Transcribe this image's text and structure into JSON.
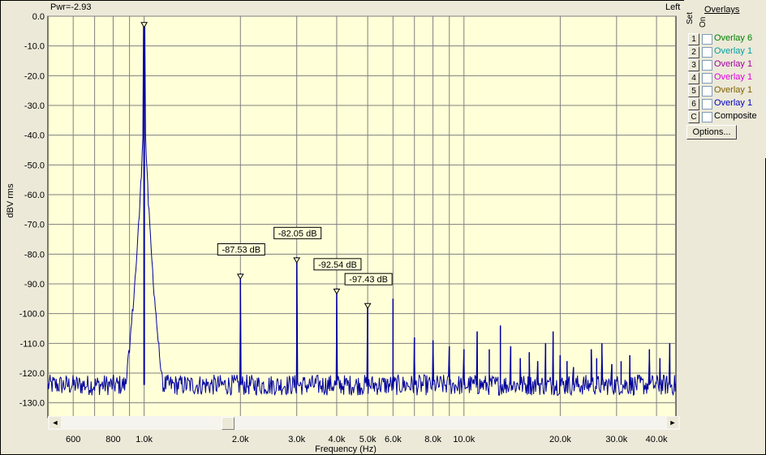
{
  "header": {
    "power_readout": "Pwr=-2.93",
    "channel": "Left"
  },
  "overlays": {
    "title": "Overlays",
    "set_header": "Set",
    "on_header": "On",
    "rows": [
      {
        "num": "1",
        "label": "Overlay 6",
        "color": "#008000",
        "checked": false
      },
      {
        "num": "2",
        "label": "Overlay 1",
        "color": "#00a0a0",
        "checked": false
      },
      {
        "num": "3",
        "label": "Overlay 1",
        "color": "#a000a0",
        "checked": false
      },
      {
        "num": "4",
        "label": "Overlay 1",
        "color": "#e000e0",
        "checked": false
      },
      {
        "num": "5",
        "label": "Overlay 1",
        "color": "#806000",
        "checked": false
      },
      {
        "num": "6",
        "label": "Overlay 1",
        "color": "#0000c0",
        "checked": false
      },
      {
        "num": "C",
        "label": "Composite",
        "color": "#000000",
        "checked": false
      }
    ],
    "options_label": "Options..."
  },
  "scrollbar": {
    "left_arrow": "◄",
    "right_arrow": "►",
    "position": 0.27
  },
  "chart_data": {
    "type": "line",
    "xlabel": "Frequency (Hz)",
    "ylabel": "dBV rms",
    "x_scale": "log",
    "xlim": [
      500,
      46000
    ],
    "ylim": [
      -135,
      0
    ],
    "grid": true,
    "background": "#ffffd8",
    "trace_color": "#0000a0",
    "x_ticks": [
      {
        "value": 600,
        "label": "600"
      },
      {
        "value": 800,
        "label": "800"
      },
      {
        "value": 1000,
        "label": "1.0k"
      },
      {
        "value": 2000,
        "label": "2.0k"
      },
      {
        "value": 3000,
        "label": "3.0k"
      },
      {
        "value": 4000,
        "label": "4.0k"
      },
      {
        "value": 5000,
        "label": "5.0k"
      },
      {
        "value": 6000,
        "label": "6.0k"
      },
      {
        "value": 8000,
        "label": "8.0k"
      },
      {
        "value": 10000,
        "label": "10.0k"
      },
      {
        "value": 20000,
        "label": "20.0k"
      },
      {
        "value": 30000,
        "label": "30.0k"
      },
      {
        "value": 40000,
        "label": "40.0k"
      }
    ],
    "y_ticks": [
      {
        "value": 0,
        "label": "0.0"
      },
      {
        "value": -10,
        "label": "-10.0"
      },
      {
        "value": -20,
        "label": "-20.0"
      },
      {
        "value": -30,
        "label": "-30.0"
      },
      {
        "value": -40,
        "label": "-40.0"
      },
      {
        "value": -50,
        "label": "-50.0"
      },
      {
        "value": -60,
        "label": "-60.0"
      },
      {
        "value": -70,
        "label": "-70.0"
      },
      {
        "value": -80,
        "label": "-80.0"
      },
      {
        "value": -90,
        "label": "-90.0"
      },
      {
        "value": -100,
        "label": "-100.0"
      },
      {
        "value": -110,
        "label": "-110.0"
      },
      {
        "value": -120,
        "label": "-120.0"
      },
      {
        "value": -130,
        "label": "-130.0"
      }
    ],
    "noise_floor": -124,
    "fundamental": {
      "x": 1000,
      "y": -2.93
    },
    "harmonics": [
      {
        "x": 2000,
        "y": -86.5
      },
      {
        "x": 3000,
        "y": -81.0
      },
      {
        "x": 4000,
        "y": -91.5
      },
      {
        "x": 5000,
        "y": -96.5
      },
      {
        "x": 6000,
        "y": -95.0
      },
      {
        "x": 7000,
        "y": -108.0
      },
      {
        "x": 8000,
        "y": -109.0
      },
      {
        "x": 9000,
        "y": -111.0
      },
      {
        "x": 10000,
        "y": -112.0
      },
      {
        "x": 11000,
        "y": -106.0
      },
      {
        "x": 12000,
        "y": -112.0
      },
      {
        "x": 13000,
        "y": -104.0
      },
      {
        "x": 14000,
        "y": -111.0
      },
      {
        "x": 15000,
        "y": -115.0
      },
      {
        "x": 16000,
        "y": -113.0
      },
      {
        "x": 17000,
        "y": -116.0
      },
      {
        "x": 18000,
        "y": -110.0
      },
      {
        "x": 19000,
        "y": -106.0
      },
      {
        "x": 20000,
        "y": -114.0
      },
      {
        "x": 21000,
        "y": -116.0
      },
      {
        "x": 22000,
        "y": -118.0
      },
      {
        "x": 25000,
        "y": -112.0
      },
      {
        "x": 26000,
        "y": -115.0
      },
      {
        "x": 27000,
        "y": -110.0
      },
      {
        "x": 29000,
        "y": -117.0
      },
      {
        "x": 31000,
        "y": -116.0
      },
      {
        "x": 33000,
        "y": -114.0
      },
      {
        "x": 38000,
        "y": -112.0
      },
      {
        "x": 41000,
        "y": -115.0
      },
      {
        "x": 44000,
        "y": -110.0
      }
    ],
    "markers": [
      {
        "x": 1000,
        "y": -2.93,
        "label": ""
      },
      {
        "x": 2000,
        "y": -87.53,
        "label": "-87.53 dB",
        "label_y": -79.5
      },
      {
        "x": 3000,
        "y": -82.05,
        "label": "-82.05 dB",
        "label_y": -74
      },
      {
        "x": 4000,
        "y": -92.54,
        "label": "-92.54 dB",
        "label_y": -84.5
      },
      {
        "x": 5000,
        "y": -97.43,
        "label": "-97.43 dB",
        "label_y": -89.5
      }
    ]
  }
}
